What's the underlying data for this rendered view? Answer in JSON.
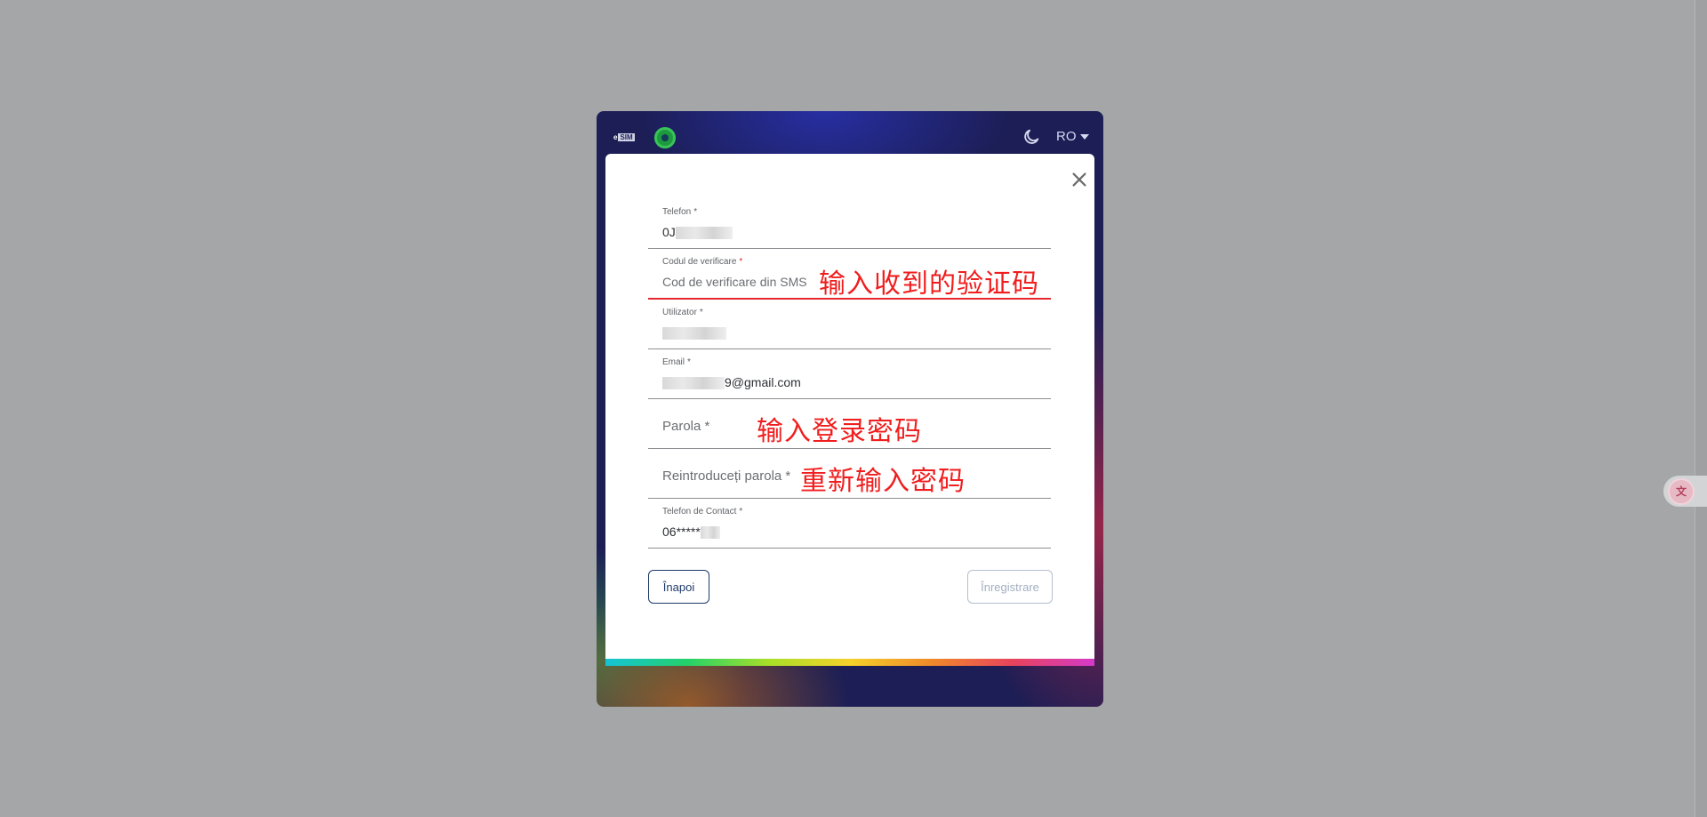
{
  "header": {
    "logo_text": "e",
    "logo_box": "SIM",
    "language": "RO",
    "icons": {
      "brand": "brand-circle-icon",
      "theme": "moon-icon",
      "lang_caret": "chevron-down-icon"
    }
  },
  "form": {
    "telefon": {
      "label": "Telefon",
      "required": "*",
      "value": "0J"
    },
    "cod": {
      "label": "Codul de verificare",
      "required": "*",
      "placeholder": "Cod de verificare din SMS"
    },
    "utilizator": {
      "label": "Utilizator",
      "required": "*",
      "value": ""
    },
    "email": {
      "label": "Email",
      "required": "*",
      "value_suffix": "9@gmail.com"
    },
    "parola": {
      "label": "Parola",
      "required": "*"
    },
    "reparola": {
      "label": "Reintroduceți parola",
      "required": "*"
    },
    "contact": {
      "label": "Telefon de Contact",
      "required": "*",
      "value": "06*****"
    }
  },
  "annotations": {
    "code_note": "输入收到的验证码",
    "password_note": "输入登录密码",
    "repassword_note": "重新输入密码"
  },
  "buttons": {
    "back": "Înapoi",
    "register": "Înregistrare"
  },
  "colors": {
    "accent_error": "#e5282f",
    "annotation": "#f01e1e",
    "primary": "#1e3a6a",
    "frame_bg": "#1c1e55"
  }
}
